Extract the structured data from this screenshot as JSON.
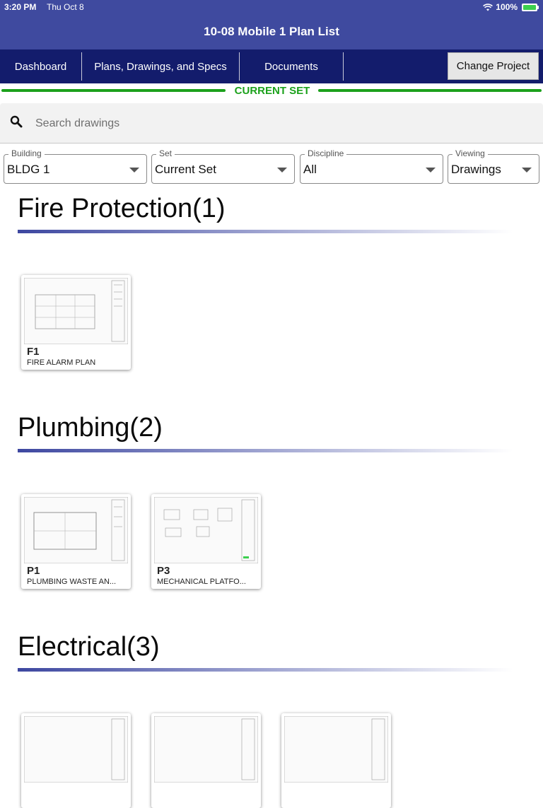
{
  "status": {
    "time": "3:20 PM",
    "date": "Thu Oct 8",
    "battery": "100%"
  },
  "header": {
    "title": "10-08 Mobile 1 Plan List"
  },
  "nav": {
    "tabs": [
      "Dashboard",
      "Plans, Drawings, and Specs",
      "Documents"
    ],
    "change_project": "Change Project"
  },
  "banner": {
    "label": "CURRENT SET",
    "color": "#1ca11c"
  },
  "search": {
    "placeholder": "Search drawings",
    "value": ""
  },
  "filters": [
    {
      "label": "Building",
      "value": "BLDG 1"
    },
    {
      "label": "Set",
      "value": "Current Set"
    },
    {
      "label": "Discipline",
      "value": "All"
    },
    {
      "label": "Viewing",
      "value": "Drawings"
    }
  ],
  "sections": [
    {
      "title": "Fire Protection(1)",
      "sheets": [
        {
          "code": "F1",
          "name": "FIRE ALARM PLAN"
        }
      ]
    },
    {
      "title": "Plumbing(2)",
      "sheets": [
        {
          "code": "P1",
          "name": "PLUMBING WASTE AN..."
        },
        {
          "code": "P3",
          "name": "MECHANICAL PLATFO..."
        }
      ]
    },
    {
      "title": "Electrical(3)",
      "sheets": [
        {
          "code": "",
          "name": ""
        },
        {
          "code": "",
          "name": ""
        },
        {
          "code": "",
          "name": ""
        }
      ]
    }
  ],
  "colors": {
    "header": "#3f4a9f",
    "nav": "#131c6c",
    "accent": "#3d47a0"
  }
}
